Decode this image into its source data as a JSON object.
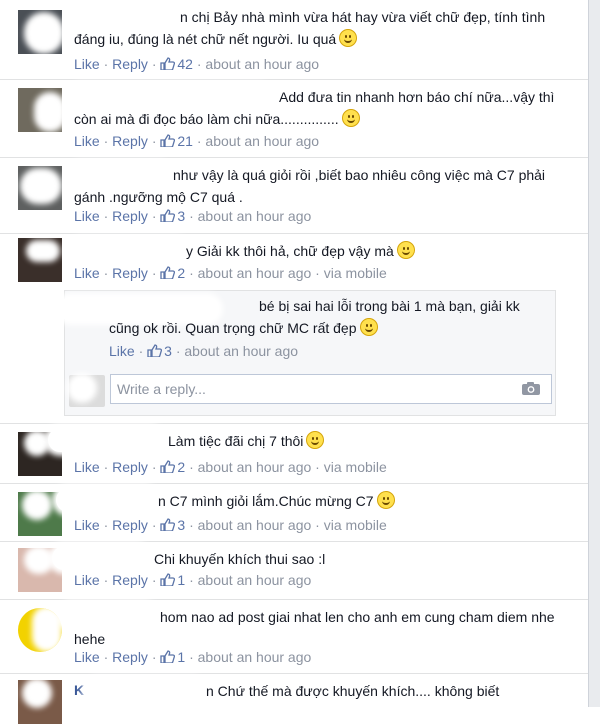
{
  "actions": {
    "like": "Like",
    "reply": "Reply",
    "sep": " · "
  },
  "comments": [
    {
      "text": "n chị Bảy nhà mình vừa hát hay vừa viết chữ đẹp, tính tình đáng iu, đúng là nét chữ nết người. Iu quá",
      "likes": "42",
      "time": "about an hour ago",
      "via": ""
    },
    {
      "text": "Add đưa tin nhanh hơn báo chí nữa...vậy thì còn ai mà đi đọc báo làm chi nữa...............",
      "likes": "21",
      "time": "about an hour ago",
      "via": ""
    },
    {
      "text": "như vậy là quá giỏi rồi ,biết bao nhiêu công việc mà C7 phải gánh .ngưỡng mộ C7 quá .",
      "likes": "3",
      "time": "about an hour ago",
      "via": ""
    },
    {
      "text": "y Giải kk thôi hả, chữ đẹp vậy mà",
      "likes": "2",
      "time": "about an hour ago",
      "via": "via mobile"
    },
    {
      "text": "Làm tiệc đãi chị 7 thôi",
      "likes": "2",
      "time": "about an hour ago",
      "via": "via mobile"
    },
    {
      "text": "n C7 mình giỏi lắm.Chúc mừng C7",
      "likes": "3",
      "time": "about an hour ago",
      "via": "via mobile"
    },
    {
      "text": "Chi khuyến khích thui sao :l",
      "likes": "1",
      "time": "about an hour ago",
      "via": ""
    },
    {
      "text": "hom nao ad post giai nhat len cho anh em cung cham diem nhe hehe",
      "likes": "1",
      "time": "about an hour ago",
      "via": ""
    },
    {
      "text": "n Chứ thế mà được khuyến khích.... không biết",
      "likes": "",
      "time": "",
      "via": ""
    }
  ],
  "reply": {
    "text": "bé bị sai hai lỗi trong bài 1 mà bạn, giải kk cũng ok rồi. Quan trọng chữ MC rất đẹp",
    "likes": "3",
    "time": "about an hour ago"
  },
  "reply_input": {
    "placeholder": "Write a reply..."
  },
  "last_name_initial": "K",
  "colors": {
    "link": "#5b74a8",
    "meta": "#8c93a0",
    "text": "#141823"
  }
}
